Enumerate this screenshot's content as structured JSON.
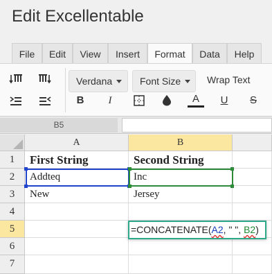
{
  "app": {
    "title": "Edit Excellentable"
  },
  "tabs": [
    {
      "label": "File"
    },
    {
      "label": "Edit"
    },
    {
      "label": "View"
    },
    {
      "label": "Insert"
    },
    {
      "label": "Format",
      "active": true
    },
    {
      "label": "Data"
    },
    {
      "label": "Help"
    }
  ],
  "toolbar": {
    "font_family": "Verdana",
    "font_size": "Font Size",
    "wrap_text": "Wrap Text",
    "bold": "B",
    "italic": "I",
    "font_color": "A",
    "underline": "U",
    "strikethrough": "S",
    "icons": [
      "insert-row-above-icon",
      "insert-row-below-icon",
      "indent-left-icon",
      "indent-right-icon",
      "borders-icon",
      "fill-color-icon"
    ]
  },
  "formula_bar": {
    "cell_ref": "B5",
    "value": ""
  },
  "grid": {
    "columns": [
      "A",
      "B"
    ],
    "rows": [
      "1",
      "2",
      "3",
      "4",
      "5",
      "6",
      "7"
    ],
    "cells": {
      "A1": "First String",
      "B1": "Second String",
      "A2": "Addteq",
      "B2": "Inc",
      "A3": "New",
      "B3": "Jersey"
    },
    "editor": {
      "prefix": "=CONCATENATE(",
      "ref_a": "A2",
      "middle": ", \" \", ",
      "ref_b": "B2",
      "suffix": ")"
    }
  },
  "colors": {
    "selected_header": "#fbe7a0",
    "ref_a": "#2244cc",
    "ref_b": "#2e8b3a",
    "editor_border": "#2ea88a"
  }
}
